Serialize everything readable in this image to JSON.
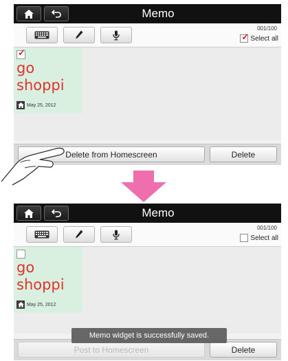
{
  "app": {
    "title": "Memo"
  },
  "colors": {
    "memo_text": "#e0332b",
    "memo_bg": "#d9efe0",
    "arrow": "#ef6fae",
    "titlebar": "#111111"
  },
  "icons": {
    "home": "home-icon",
    "back": "back-arrow-icon",
    "keyboard": "keyboard-icon",
    "pen": "pen-icon",
    "mic": "microphone-icon"
  },
  "screens": {
    "before": {
      "counter": "001/100",
      "select_all_label": "Select all",
      "select_all_checked": true,
      "memo": {
        "text": "go\nshoppi",
        "date": "May 25, 2012",
        "checked": true
      },
      "left_button": "Delete from Homescreen",
      "right_button": "Delete"
    },
    "after": {
      "counter": "001/100",
      "select_all_label": "Select all",
      "select_all_checked": false,
      "memo": {
        "text": "go\nshoppi",
        "date": "May 25, 2012",
        "checked": false
      },
      "left_button": "Post to Homescreen",
      "right_button": "Delete",
      "toast": "Memo widget is successfully saved."
    }
  }
}
